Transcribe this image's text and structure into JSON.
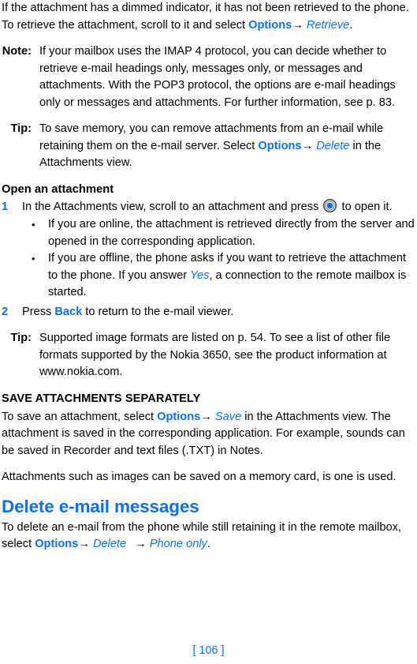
{
  "colors": {
    "accent_blue": "#0d6ff0",
    "text_black": "#000000",
    "page_background": "#ffffff"
  },
  "intro_paragraph": {
    "text_1": "If the attachment has a dimmed indicator, it has not been retrieved to the phone. To retrieve the attachment, scroll to it and select ",
    "keyword_options": "Options",
    "arrow": "→",
    "italic_retrieve": "Retrieve",
    "text_end": "."
  },
  "note_block": {
    "label": "Note:",
    "text": "If your mailbox uses the IMAP 4 protocol, you can decide whether to retrieve e-mail headings only, messages only, or messages and attachments. With the POP3 protocol, the options are e-mail headings only or messages and attachments. For further information, see p. 83."
  },
  "tip_block_1": {
    "label": "Tip:",
    "text_1": "To save memory, you can remove attachments from an e-mail while retaining them on the e-mail server. Select ",
    "keyword_options": "Options",
    "arrow": "→",
    "italic_delete": "Delete",
    "text_end": " in the Attachments view."
  },
  "open_attachment_section": {
    "heading": "Open an attachment",
    "step_1": {
      "number": "1",
      "text_before_icon": "In the Attachments view, scroll to an attachment and press",
      "icon_name": "joystick-scroll-key-icon",
      "text_after_icon": "to open it."
    },
    "bullets": [
      {
        "marker": "•",
        "text": "If you are online, the attachment is retrieved directly from the server and opened in the corresponding application."
      },
      {
        "marker": "•",
        "text_1": "If you are offline, the phone asks if you want to retrieve the attachment to the phone. If you answer ",
        "italic_yes": "Yes",
        "text_end": ", a connection to the remote mailbox is started."
      }
    ],
    "step_2": {
      "number": "2",
      "text_1": "Press ",
      "keyword_back": "Back",
      "text_end": " to return to the e-mail viewer."
    }
  },
  "tip_block_2": {
    "label": "Tip:",
    "text": "Supported image formats are listed on p. 54. To see a list of other file formats supported by the Nokia 3650, see the product information at www.nokia.com."
  },
  "save_attachments_section": {
    "heading": "SAVE ATTACHMENTS SEPARATELY",
    "paragraph_1_text_1": "To save an attachment, select ",
    "paragraph_1_keyword_options": "Options",
    "paragraph_1_arrow": "→",
    "paragraph_1_italic_save": "Save",
    "paragraph_1_text_end": " in the Attachments view. The attachment is saved in the corresponding application. For example, sounds can be saved in Recorder and text files (.TXT) in Notes.",
    "paragraph_2": "Attachments such as images can be saved on a memory card, is one is used."
  },
  "delete_section": {
    "heading": "Delete e-mail messages",
    "text_1": "To delete an e-mail from the phone while still retaining it in the remote mailbox, select ",
    "keyword_options": "Options",
    "arrow_1": "→",
    "italic_delete": "Delete",
    "arrow_2": "→",
    "italic_phone_only": "Phone only",
    "text_end": "."
  },
  "footer": {
    "page_number": "[ 106 ]"
  }
}
